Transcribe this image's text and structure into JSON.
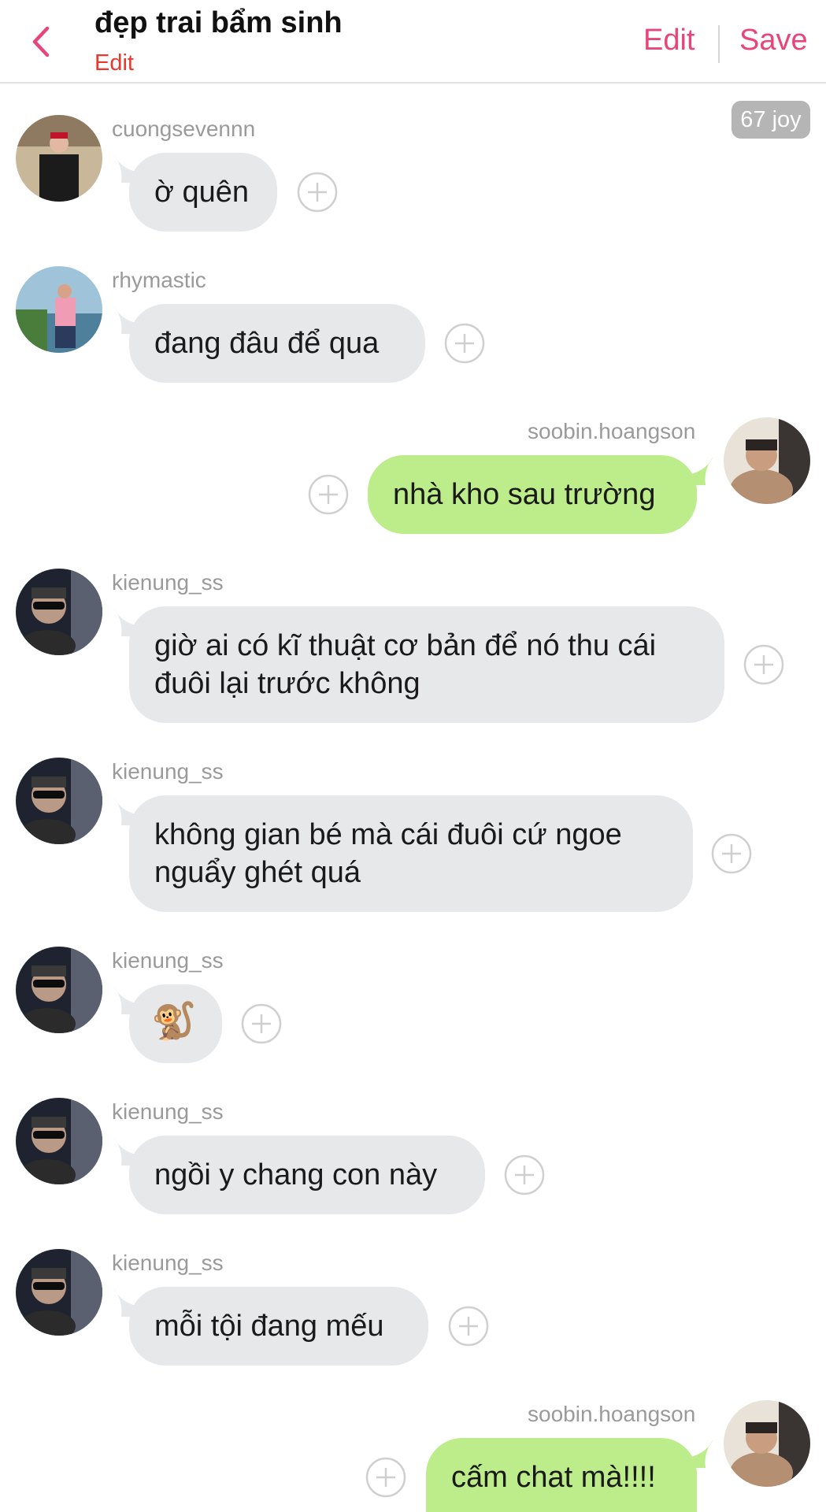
{
  "header": {
    "title": "đẹp trai bẩm sinh",
    "subtitle_link": "Edit",
    "edit_label": "Edit",
    "save_label": "Save",
    "back_icon": "chevron-left-icon",
    "accent_color": "#e8457a",
    "subtitle_color": "#e8392b"
  },
  "joy_badge": "67 joy",
  "messages": [
    {
      "user": "cuongsevennn",
      "text": "ờ quên",
      "side": "in"
    },
    {
      "user": "rhymastic",
      "text": "đang đâu để qua",
      "side": "in"
    },
    {
      "user": "soobin.hoangson",
      "text": "nhà kho sau trường",
      "side": "out"
    },
    {
      "user": "kienung_ss",
      "text": "giờ ai có kĩ thuật cơ bản để nó thu cái đuôi lại trước không",
      "side": "in"
    },
    {
      "user": "kienung_ss",
      "text": "không gian bé mà cái đuôi cứ ngoe nguẩy ghét quá",
      "side": "in"
    },
    {
      "user": "kienung_ss",
      "text": "🐒",
      "side": "in"
    },
    {
      "user": "kienung_ss",
      "text": "ngồi y chang con này",
      "side": "in"
    },
    {
      "user": "kienung_ss",
      "text": "mỗi tội đang mếu",
      "side": "in"
    },
    {
      "user": "soobin.hoangson",
      "text": "cấm chat mà!!!!",
      "side": "out"
    }
  ],
  "colors": {
    "incoming_bubble": "#e6e8ea",
    "outgoing_bubble": "#bdec8a",
    "username": "#9a9a9a",
    "badge": "#b5b5b5"
  },
  "icons": {
    "add_reaction": "plus-circle-icon"
  }
}
